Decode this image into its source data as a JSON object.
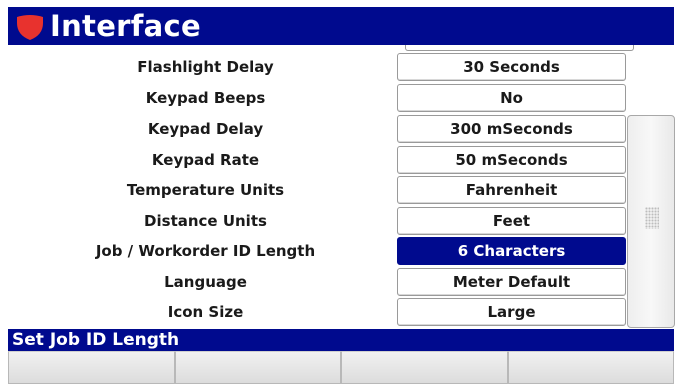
{
  "header": {
    "title": "Interface",
    "icon": "shield-icon",
    "accent": "#000a8e",
    "icon_color": "#e8322e"
  },
  "settings": [
    {
      "label": "Flashlight Delay",
      "value": "30 Seconds",
      "selected": false
    },
    {
      "label": "Keypad Beeps",
      "value": "No",
      "selected": false
    },
    {
      "label": "Keypad Delay",
      "value": "300 mSeconds",
      "selected": false
    },
    {
      "label": "Keypad Rate",
      "value": "50 mSeconds",
      "selected": false
    },
    {
      "label": "Temperature Units",
      "value": "Fahrenheit",
      "selected": false
    },
    {
      "label": "Distance Units",
      "value": "Feet",
      "selected": false
    },
    {
      "label": "Job / Workorder ID Length",
      "value": "6 Characters",
      "selected": true
    },
    {
      "label": "Language",
      "value": "Meter Default",
      "selected": false
    },
    {
      "label": "Icon Size",
      "value": "Large",
      "selected": false
    }
  ],
  "status": {
    "text": "Set Job ID Length"
  },
  "softkeys": [
    "",
    "",
    "",
    ""
  ]
}
